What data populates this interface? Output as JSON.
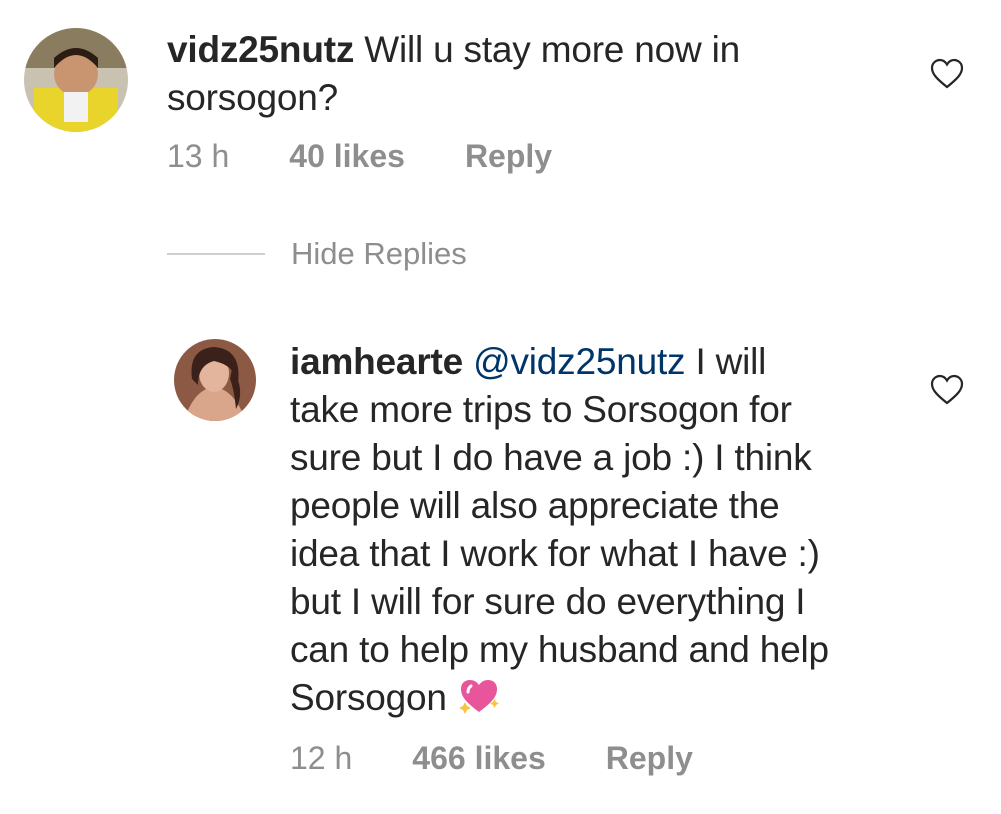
{
  "comments": [
    {
      "username": "vidz25nutz",
      "text": "Will u stay more now in sorsogon?",
      "time": "13 h",
      "likes": "40 likes",
      "reply_label": "Reply",
      "avatar_icon": "user-avatar",
      "like_icon": "heart-outline-icon"
    },
    {
      "username": "iamhearte",
      "mention": "@vidz25nutz",
      "line1_rest": "I will",
      "lines": [
        "take more trips to Sorsogon for",
        "sure but I do have a job :) I think",
        "people will also appreciate the",
        "idea that I work for what I have :)",
        "but I will for sure do everything I",
        "can to help my husband and help",
        "Sorsogon"
      ],
      "emoji": "sparkling-heart-emoji",
      "time": "12 h",
      "likes": "466 likes",
      "reply_label": "Reply",
      "avatar_icon": "user-avatar",
      "like_icon": "heart-outline-icon"
    }
  ],
  "hide_replies_label": "Hide Replies",
  "colors": {
    "text": "#262626",
    "meta": "#8e8e8e",
    "mention": "#003569",
    "emoji_pink": "#e8559a"
  }
}
